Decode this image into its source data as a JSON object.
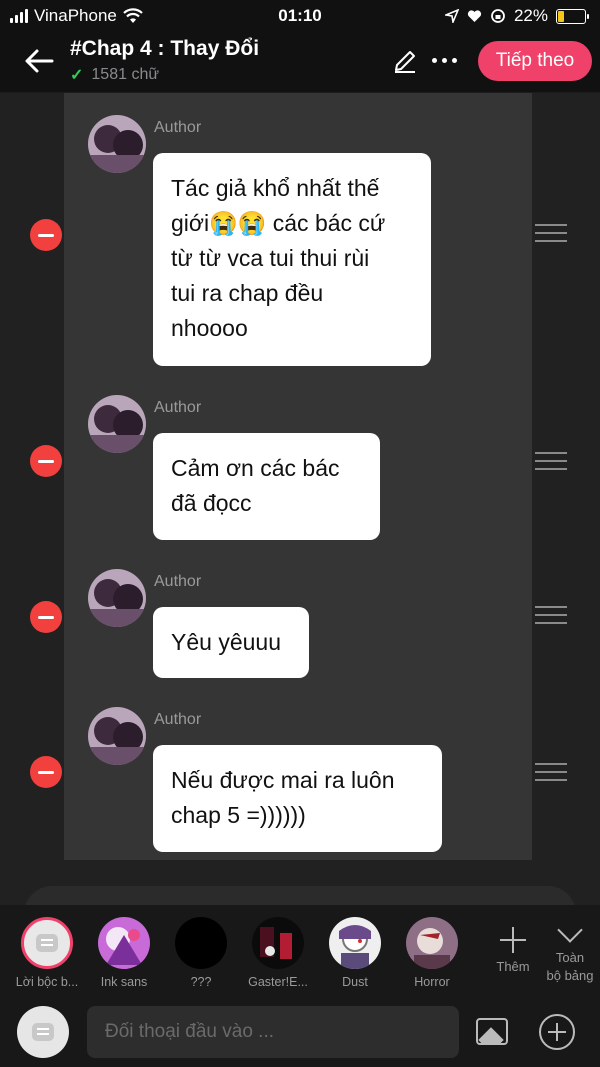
{
  "status_bar": {
    "carrier": "VinaPhone",
    "time": "01:10",
    "battery": "22%",
    "battery_level": 0.22
  },
  "header": {
    "title": "#Chap 4 : Thay Đổi",
    "word_count": "1581 chữ",
    "next_label": "Tiếp theo"
  },
  "messages": [
    {
      "author": "Author",
      "lines": [
        "Tác giả khổ nhất thế",
        "giới😭😭 các bác cứ",
        "từ từ vca tui thui rùi",
        "tui ra chap đều",
        "nhoooo"
      ]
    },
    {
      "author": "Author",
      "lines": [
        "Cảm ơn các bác",
        "đã đọcc"
      ]
    },
    {
      "author": "Author",
      "lines": [
        "Yêu yêuuu"
      ]
    },
    {
      "author": "Author",
      "lines": [
        "Nếu được mai ra luôn",
        "chap 5 =))))))"
      ]
    }
  ],
  "characters": [
    {
      "name": "Lời bộc b...",
      "icon": "speech-bubble-icon",
      "active": true
    },
    {
      "name": "Ink sans",
      "color": "#c86bd8"
    },
    {
      "name": "???",
      "color": "#000000"
    },
    {
      "name": "Gaster!E...",
      "color": "#4a1020"
    },
    {
      "name": "Dust",
      "color": "#efefef"
    },
    {
      "name": "Horror",
      "color": "#8f6f86"
    }
  ],
  "toolbar": {
    "add_label": "Thêm",
    "all_label_line1": "Toàn",
    "all_label_line2": "bộ bảng"
  },
  "input": {
    "placeholder": "Đối thoại đầu vào ..."
  }
}
